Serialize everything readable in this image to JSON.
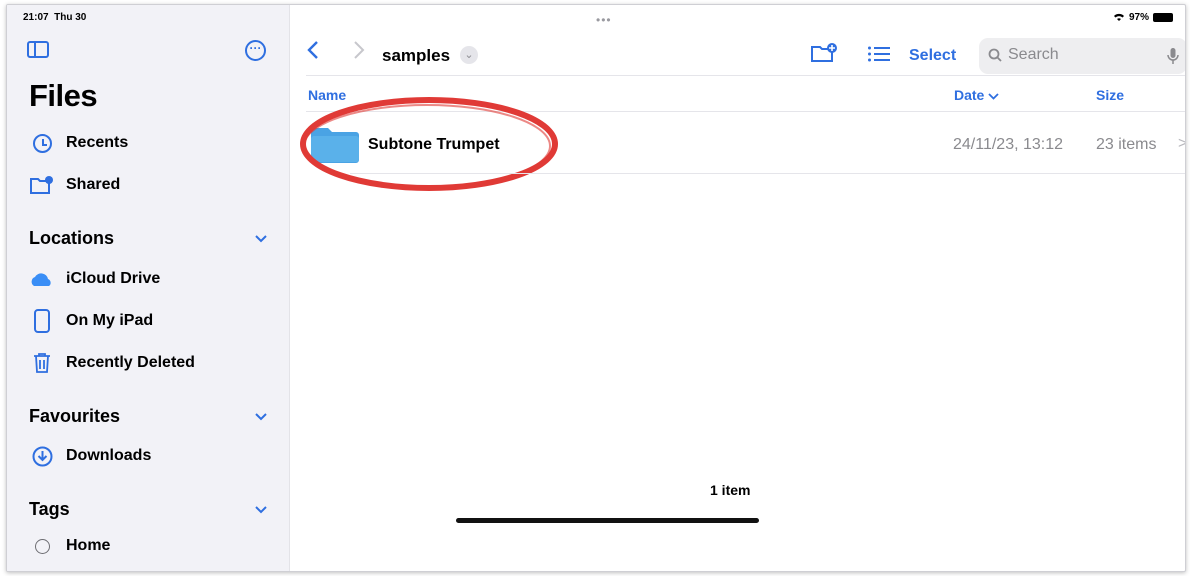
{
  "status": {
    "time": "21:07",
    "date": "Thu 30",
    "battery": "97%"
  },
  "sidebar": {
    "title": "Files",
    "top_items": [
      {
        "label": "Recents",
        "icon": "clock-icon"
      },
      {
        "label": "Shared",
        "icon": "shared-folder-icon"
      }
    ],
    "sections": [
      {
        "title": "Locations",
        "items": [
          {
            "label": "iCloud Drive",
            "icon": "cloud-icon"
          },
          {
            "label": "On My iPad",
            "icon": "ipad-icon"
          },
          {
            "label": "Recently Deleted",
            "icon": "trash-icon"
          }
        ]
      },
      {
        "title": "Favourites",
        "items": [
          {
            "label": "Downloads",
            "icon": "download-icon"
          }
        ]
      },
      {
        "title": "Tags",
        "items": [
          {
            "label": "Home",
            "icon": "tag-circle-icon"
          }
        ]
      }
    ]
  },
  "toolbar": {
    "folder_title": "samples",
    "select_label": "Select",
    "search_placeholder": "Search"
  },
  "columns": {
    "name": "Name",
    "date": "Date",
    "size": "Size"
  },
  "rows": [
    {
      "name": "Subtone Trumpet",
      "date": "24/11/23, 13:12",
      "size": "23 items"
    }
  ],
  "footer": {
    "count": "1 item"
  },
  "colors": {
    "accent": "#2f6fe0",
    "folder": "#5ab1ea",
    "highlight": "#e03a36"
  }
}
